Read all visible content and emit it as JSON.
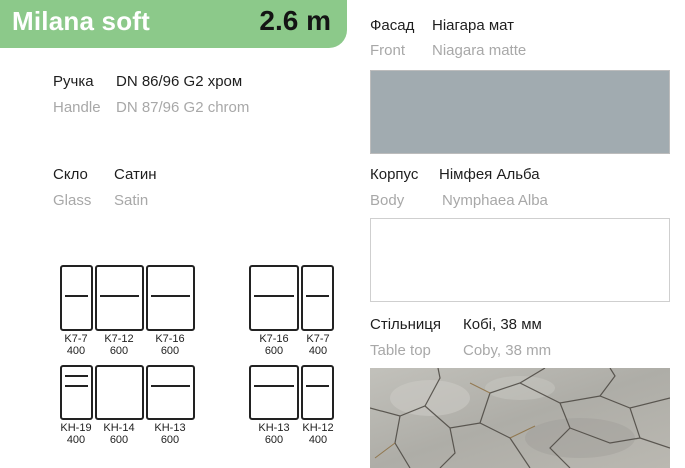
{
  "header": {
    "name": "Milana soft",
    "size": "2.6 m"
  },
  "specs": {
    "handle": {
      "ua_label": "Ручка",
      "ua_value": "DN 86/96 G2 хром",
      "en_label": "Handle",
      "en_value": "DN 87/96 G2 chrom"
    },
    "glass": {
      "ua_label": "Скло",
      "ua_value": "Сатин",
      "en_label": "Glass",
      "en_value": "Satin"
    }
  },
  "materials": {
    "front": {
      "ua_label": "Фасад",
      "ua_value": "Ніагара мат",
      "en_label": "Front",
      "en_value": "Niagara matte",
      "color": "#a1abb0"
    },
    "body": {
      "ua_label": "Корпус",
      "ua_value": "Німфея Альба",
      "en_label": "Body",
      "en_value": "Nymphaea Alba",
      "color": "#ffffff"
    },
    "tabletop": {
      "ua_label": "Стільниця",
      "ua_value": "Кобі, 38 мм",
      "en_label": "Table top",
      "en_value": "Coby, 38 mm",
      "color": "#b4b3ad"
    }
  },
  "header_color": "#8cc98a",
  "modules": [
    {
      "code": "K7-7",
      "width": "400"
    },
    {
      "code": "K7-12",
      "width": "600"
    },
    {
      "code": "K7-16",
      "width": "600"
    },
    {
      "code": "K7-16",
      "width": "600"
    },
    {
      "code": "K7-7",
      "width": "400"
    },
    {
      "code": "KH-19",
      "width": "400"
    },
    {
      "code": "KH-14",
      "width": "600"
    },
    {
      "code": "KH-13",
      "width": "600"
    },
    {
      "code": "KH-13",
      "width": "600"
    },
    {
      "code": "KH-12",
      "width": "400"
    }
  ]
}
